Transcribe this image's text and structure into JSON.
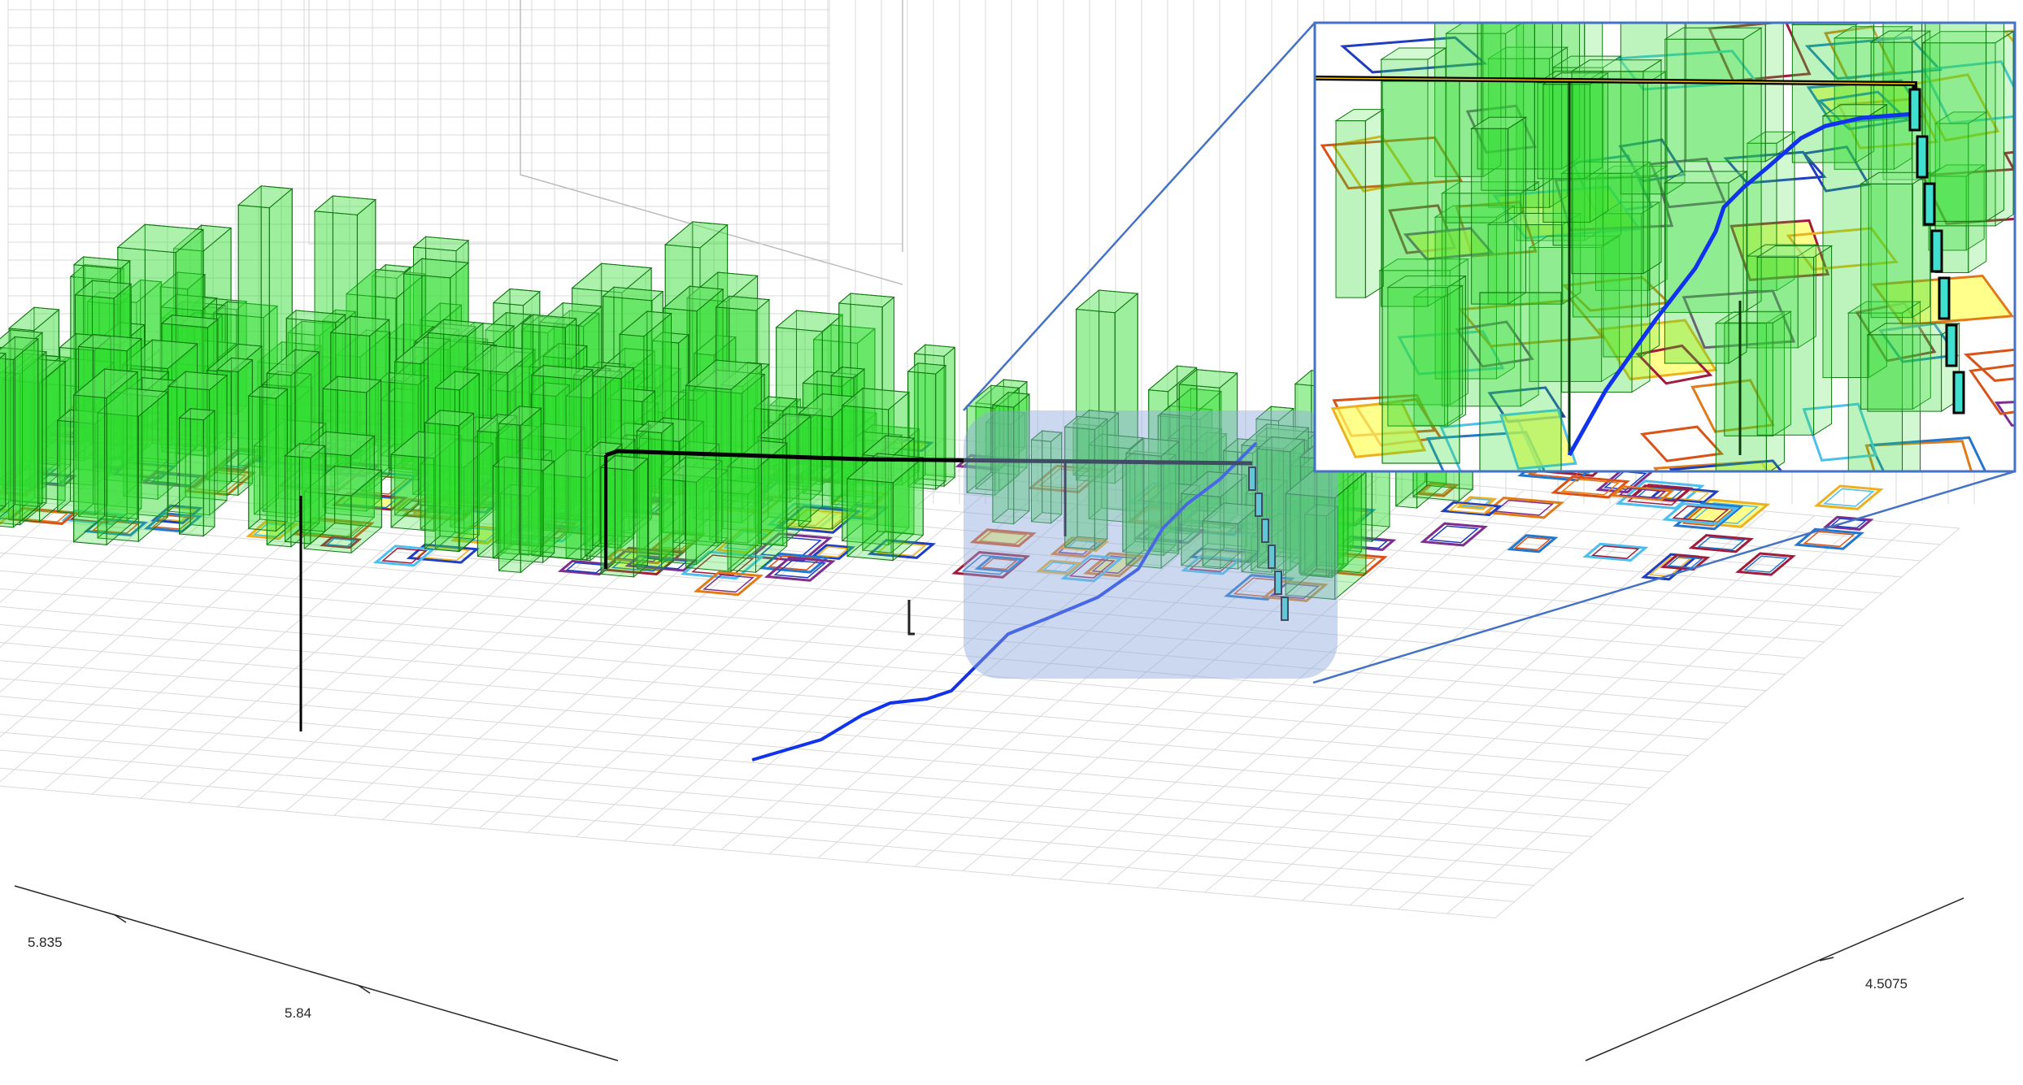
{
  "colors": {
    "building_fill": "#33dd33",
    "building_edge": "#117711",
    "ground_fill": "#ffff66",
    "route_low": "#1133ee",
    "route_high": "#000000",
    "highlight_segment": "#40e0d0",
    "inset_border": "#4472c4",
    "zoom_region": "#8fa8dc",
    "footprint_palette": [
      "#a01c3c",
      "#e07b1a",
      "#edb120",
      "#2277cc",
      "#7e2f8e",
      "#4dbeee",
      "#d95319",
      "#1f3fbf"
    ],
    "grid": "#d9d9d9",
    "axis": "#262626"
  },
  "icons": {
    "route_marker": "pin-marker-icon"
  },
  "chart_data": {
    "type": "3d-scene",
    "title": "",
    "xlabel": "",
    "ylabel": "",
    "zlabel": "",
    "grid": true,
    "legend": "none",
    "x_axis": {
      "ticks": [
        {
          "value": 5.835,
          "label": "5.835"
        },
        {
          "value": 5.84,
          "label": "5.84"
        }
      ]
    },
    "y_axis": {
      "ticks": [
        {
          "value": 4.5075,
          "label": "4.5075"
        }
      ]
    },
    "inset": {
      "kind": "zoomed-view",
      "source_region": "highlighted area right of center"
    },
    "series": [
      {
        "kind": "buildings",
        "count_estimate": 200
      },
      {
        "kind": "building-footprints",
        "count_estimate": 150
      },
      {
        "kind": "route",
        "segments": [
          "ground-level path",
          "elevated path",
          "vertical climb"
        ]
      }
    ]
  }
}
